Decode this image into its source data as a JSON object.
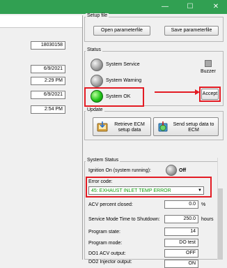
{
  "window": {
    "minimize_glyph": "—",
    "maximize_glyph": "☐",
    "close_glyph": "✕"
  },
  "left": {
    "values": [
      "18030158",
      "6/9/2021",
      "2:29 PM",
      "6/9/2021",
      "2:54 PM"
    ]
  },
  "setup_file": {
    "title": "Setup file",
    "open_label": "Open parameterfile",
    "save_label": "Save parameterfile"
  },
  "status": {
    "title": "Status",
    "items": [
      {
        "label": "System Service",
        "state": "off"
      },
      {
        "label": "System Warning",
        "state": "off"
      },
      {
        "label": "System OK",
        "state": "on"
      }
    ],
    "buzzer_label": "Buzzer",
    "accept_label": "Accept"
  },
  "update": {
    "title": "Update",
    "retrieve_label": "Retrieve ECM setup data",
    "send_label": "Send setup data to ECM"
  },
  "system_status": {
    "title": "System Status",
    "ignition_label": "Ignition On (system running):",
    "ignition_state": "Off",
    "error_code_label": "Error code:",
    "error_code_value": "45: EXHAUST INLET TEMP ERROR",
    "rows": [
      {
        "label": "ACV percent closed:",
        "value": "0.0",
        "unit": "%"
      },
      {
        "label": "Service Mode Time to Shutdown:",
        "value": "250.0",
        "unit": "hours"
      },
      {
        "label": "Program state:",
        "value": "14",
        "unit": ""
      },
      {
        "label": "Program mode:",
        "value": "DO test",
        "unit": ""
      },
      {
        "label": "DO1 ACV output:",
        "value": "OFF",
        "unit": ""
      },
      {
        "label": "DO2 Injector output:",
        "value": "ON",
        "unit": ""
      }
    ]
  },
  "colors": {
    "titlebar": "#31a052",
    "highlight": "#e31b23",
    "error_text": "#11a011"
  }
}
